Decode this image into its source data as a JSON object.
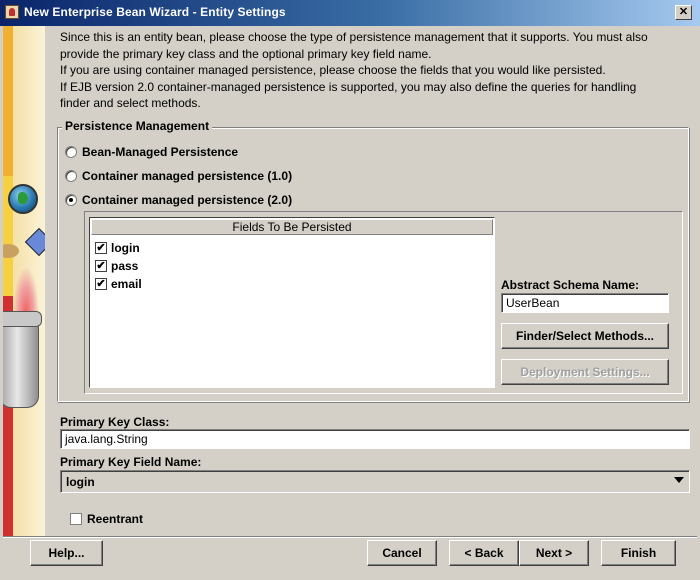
{
  "window": {
    "title": "New Enterprise Bean Wizard - Entity Settings",
    "close_glyph": "✕"
  },
  "description": {
    "line1": "Since this is an entity bean, please choose the type of persistence management that it supports.  You must also",
    "line2": "provide the primary key class and the optional primary key field name.",
    "line3": "If you are using container managed persistence, please choose the fields that you would like persisted.",
    "line4": "If EJB version 2.0 container-managed persistence is supported, you may also define the queries for handling",
    "line5": "finder and select methods."
  },
  "persistence": {
    "group_title": "Persistence Management",
    "options": [
      {
        "label": "Bean-Managed Persistence",
        "selected": false
      },
      {
        "label": "Container managed persistence (1.0)",
        "selected": false
      },
      {
        "label": "Container managed persistence (2.0)",
        "selected": true
      }
    ]
  },
  "fields_table": {
    "header": "Fields To Be Persisted",
    "rows": [
      {
        "name": "login",
        "checked": true
      },
      {
        "name": "pass",
        "checked": true
      },
      {
        "name": "email",
        "checked": true
      }
    ],
    "check_glyph": "✔"
  },
  "schema": {
    "label": "Abstract Schema Name:",
    "value": "UserBean"
  },
  "buttons": {
    "finder": "Finder/Select Methods...",
    "deployment": "Deployment Settings...",
    "help": "Help...",
    "cancel": "Cancel",
    "back": "< Back",
    "next": "Next >",
    "finish": "Finish"
  },
  "primary_key": {
    "class_label": "Primary Key Class:",
    "class_value": "java.lang.String",
    "field_label": "Primary Key Field Name:",
    "field_value": "login"
  },
  "reentrant": {
    "label": "Reentrant",
    "checked": false
  }
}
